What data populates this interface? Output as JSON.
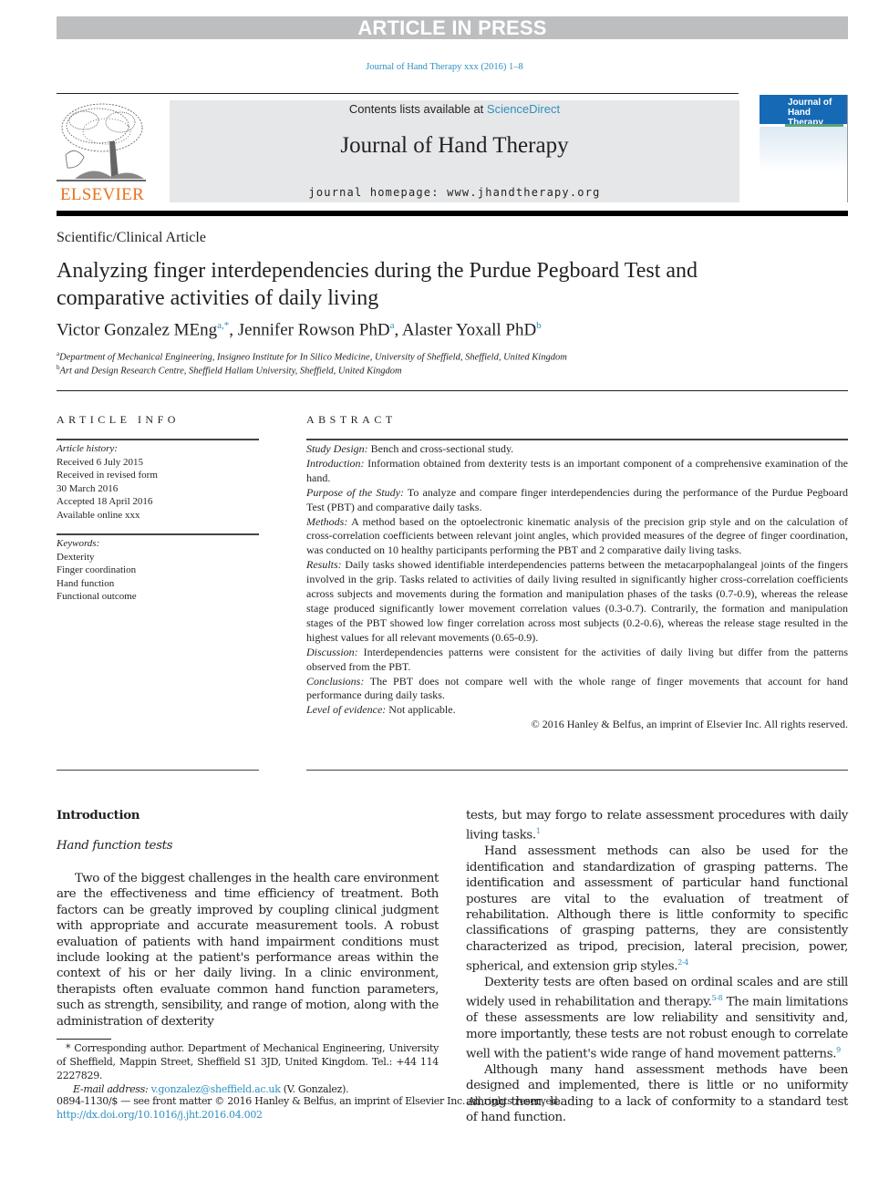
{
  "banner": "ARTICLE IN PRESS",
  "journal_ref": "Journal of Hand Therapy xxx (2016) 1–8",
  "masthead": {
    "contents_prefix": "Contents lists available at ",
    "contents_link": "ScienceDirect",
    "journal_title": "Journal of Hand Therapy",
    "homepage": "journal homepage: www.jhandtherapy.org",
    "publisher_logo": "ELSEVIER",
    "cover_title_line1": "Journal of",
    "cover_title_line2": "Hand Therapy",
    "colors": {
      "link": "#2e90c0",
      "elsevier_orange": "#e9711c",
      "cover_blue": "#1569b5",
      "banner_gray": "#bdbec0"
    }
  },
  "article": {
    "type": "Scientific/Clinical Article",
    "title": "Analyzing finger interdependencies during the Purdue Pegboard Test and comparative activities of daily living",
    "authors": [
      {
        "name": "Victor Gonzalez MEng",
        "marks": "a,*",
        "sep": ", "
      },
      {
        "name": "Jennifer Rowson PhD",
        "marks": "a",
        "sep": ", "
      },
      {
        "name": "Alaster Yoxall PhD",
        "marks": "b",
        "sep": ""
      }
    ],
    "affiliations": [
      {
        "mark": "a",
        "text": "Department of Mechanical Engineering, Insigneo Institute for In Silico Medicine, University of Sheffield, Sheffield, United Kingdom"
      },
      {
        "mark": "b",
        "text": "Art and Design Research Centre, Sheffield Hallam University, Sheffield, United Kingdom"
      }
    ]
  },
  "article_info": {
    "heading": "ARTICLE INFO",
    "history_label": "Article history:",
    "history": [
      "Received 6 July 2015",
      "Received in revised form",
      "30 March 2016",
      "Accepted 18 April 2016",
      "Available online xxx"
    ],
    "keywords_label": "Keywords:",
    "keywords": [
      "Dexterity",
      "Finger coordination",
      "Hand function",
      "Functional outcome"
    ]
  },
  "abstract": {
    "heading": "ABSTRACT",
    "sections": [
      {
        "label": "Study Design:",
        "text": " Bench and cross-sectional study."
      },
      {
        "label": "Introduction:",
        "text": " Information obtained from dexterity tests is an important component of a comprehensive examination of the hand."
      },
      {
        "label": "Purpose of the Study:",
        "text": " To analyze and compare finger interdependencies during the performance of the Purdue Pegboard Test (PBT) and comparative daily tasks."
      },
      {
        "label": "Methods:",
        "text": " A method based on the optoelectronic kinematic analysis of the precision grip style and on the calculation of cross-correlation coefficients between relevant joint angles, which provided measures of the degree of finger coordination, was conducted on 10 healthy participants performing the PBT and 2 comparative daily living tasks."
      },
      {
        "label": "Results:",
        "text": " Daily tasks showed identifiable interdependencies patterns between the metacarpophalangeal joints of the fingers involved in the grip. Tasks related to activities of daily living resulted in significantly higher cross-correlation coefficients across subjects and movements during the formation and manipulation phases of the tasks (0.7-0.9), whereas the release stage produced significantly lower movement correlation values (0.3-0.7). Contrarily, the formation and manipulation stages of the PBT showed low finger correlation across most subjects (0.2-0.6), whereas the release stage resulted in the highest values for all relevant movements (0.65-0.9)."
      },
      {
        "label": "Discussion:",
        "text": " Interdependencies patterns were consistent for the activities of daily living but differ from the patterns observed from the PBT."
      },
      {
        "label": "Conclusions:",
        "text": " The PBT does not compare well with the whole range of finger movements that account for hand performance during daily tasks."
      },
      {
        "label": "Level of evidence:",
        "text": " Not applicable."
      }
    ],
    "copyright": "© 2016 Hanley & Belfus, an imprint of Elsevier Inc. All rights reserved."
  },
  "body": {
    "section_heading": "Introduction",
    "subsection_heading": "Hand function tests",
    "left_paragraph": "Two of the biggest challenges in the health care environment are the effectiveness and time efficiency of treatment. Both factors can be greatly improved by coupling clinical judgment with appropriate and accurate measurement tools. A robust evaluation of patients with hand impairment conditions must include looking at the patient's performance areas within the context of his or her daily living. In a clinic environment, therapists often evaluate common hand function parameters, such as strength, sensibility, and range of motion, along with the administration of dexterity",
    "right_paragraphs": [
      {
        "text": "tests, but may forgo to relate assessment procedures with daily living tasks.",
        "ref": "1",
        "indent": false
      },
      {
        "text": "Hand assessment methods can also be used for the identification and standardization of grasping patterns. The identification and assessment of particular hand functional postures are vital to the evaluation of treatment of rehabilitation. Although there is little conformity to specific classifications of grasping patterns, they are consistently characterized as tripod, precision, lateral precision, power, spherical, and extension grip styles.",
        "ref": "2-4",
        "indent": true
      },
      {
        "text_before": "Dexterity tests are often based on ordinal scales and are still widely used in rehabilitation and therapy.",
        "ref_mid": "5-8",
        "text_after": " The main limitations of these assessments are low reliability and sensitivity and, more importantly, these tests are not robust enough to correlate well with the patient's wide range of hand movement patterns.",
        "ref": "9",
        "indent": true
      },
      {
        "text": "Although many hand assessment methods have been designed and implemented, there is little or no uniformity among them, leading to a lack of conformity to a standard test of hand function.",
        "ref": "",
        "indent": true
      }
    ]
  },
  "footnote": {
    "corresponding": "* Corresponding author. Department of Mechanical Engineering, University of Sheffield, Mappin Street, Sheffield S1 3JD, United Kingdom. Tel.: +44 114 2227829.",
    "email_label": "E-mail address:",
    "email": "v.gonzalez@sheffield.ac.uk",
    "email_suffix": " (V. Gonzalez).",
    "issn_line": "0894-1130/$ — see front matter © 2016 Hanley & Belfus, an imprint of Elsevier Inc. All rights reserved.",
    "doi": "http://dx.doi.org/10.1016/j.jht.2016.04.002"
  }
}
